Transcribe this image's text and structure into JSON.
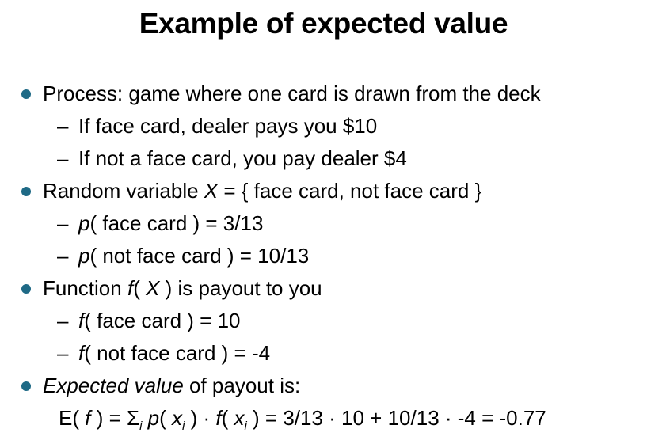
{
  "title": "Example of expected value",
  "bullet1": {
    "text": "Process: game where one card is drawn from the deck",
    "sub1": "If face card, dealer pays you $10",
    "sub2": "If not a face card, you pay dealer $4"
  },
  "bullet2": {
    "pre": "Random variable ",
    "var": "X",
    "post": " = { face card, not face card }",
    "sub1_fn": "p",
    "sub1_rest": "( face card ) = 3/13",
    "sub2_fn": "p",
    "sub2_rest": "( not face card ) = 10/13"
  },
  "bullet3": {
    "pre": "Function ",
    "fn": "f",
    "mid": "( ",
    "var": "X",
    "post": " ) is payout to you",
    "sub1_fn": "f",
    "sub1_rest": "( face card ) = 10",
    "sub2_fn": "f",
    "sub2_rest": "( not face card ) = -4"
  },
  "bullet4": {
    "italic": "Expected value",
    "post": " of payout is:"
  },
  "formula": {
    "a": "E( ",
    "f1": "f",
    "b": " ) = Σ",
    "i1": "i",
    "c": " ",
    "p": "p",
    "d": "( ",
    "x1": "x",
    "i2": "i",
    "e": " ) · ",
    "f2": "f",
    "g": "( ",
    "x2": "x",
    "i3": "i",
    "h": " ) = 3/13 · 10 + 10/13 · -4 = -0.77"
  },
  "dash_glyph": "–",
  "colors": {
    "bullet": "#1f6a86",
    "text": "#000000",
    "background": "#ffffff"
  }
}
